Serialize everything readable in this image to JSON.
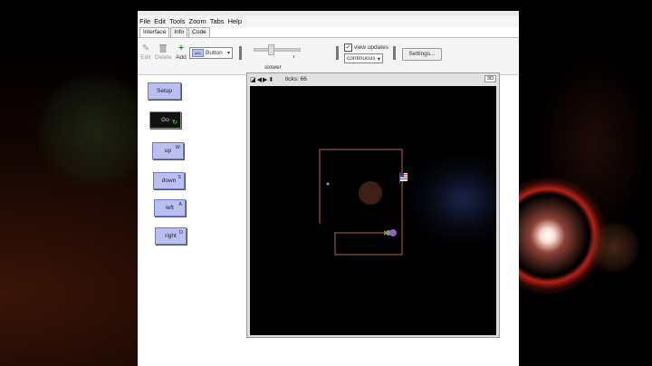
{
  "menubar": {
    "items": [
      "File",
      "Edit",
      "Tools",
      "Zoom",
      "Tabs",
      "Help"
    ]
  },
  "tabs": [
    {
      "label": "Interface",
      "active": true
    },
    {
      "label": "Info",
      "active": false
    },
    {
      "label": "Code",
      "active": false
    }
  ],
  "toolbar": {
    "edit_label": "Edit",
    "delete_label": "Delete",
    "add_label": "Add",
    "widget_type": "Button",
    "widget_swatch_text": "abc",
    "speed_label": "slower",
    "view_updates_label": "view updates",
    "view_updates_checked": true,
    "update_mode": "continuous",
    "settings_label": "Settings..."
  },
  "interface_buttons": [
    {
      "label": "Setup",
      "key": ""
    },
    {
      "label": "Go",
      "key": ""
    },
    {
      "label": "up",
      "key": "W"
    },
    {
      "label": "down",
      "key": "S"
    },
    {
      "label": "left",
      "key": "A"
    },
    {
      "label": "right",
      "key": "D"
    }
  ],
  "view": {
    "ticks_label": "ticks: 66",
    "speed_badge": "3D"
  },
  "colors": {
    "button_fill": "#b9bff0",
    "button_border": "#6f78c8",
    "path_line": "#b06a4a",
    "center_circle": "#4a2518",
    "forever_icon": "#2ec52e"
  }
}
